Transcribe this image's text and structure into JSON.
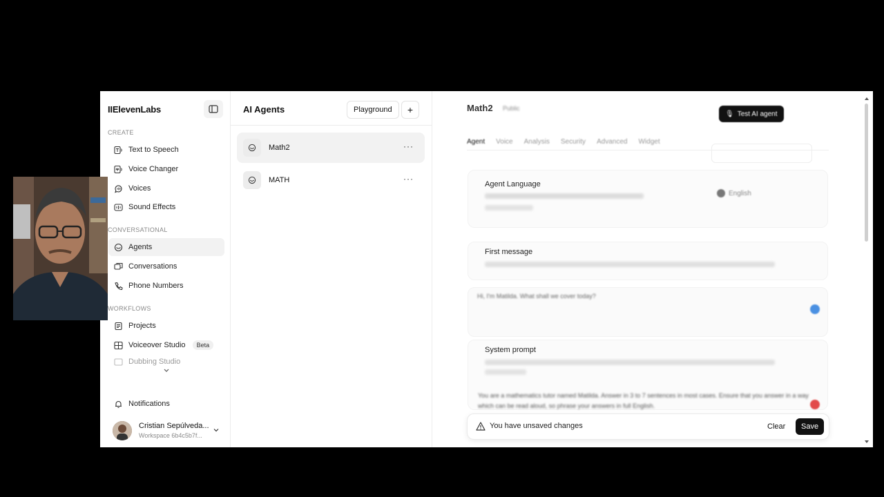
{
  "sidebar": {
    "logo": "IIElevenLabs",
    "sections": {
      "create": "CREATE",
      "conversational": "CONVERSATIONAL",
      "workflows": "WORKFLOWS"
    },
    "create_items": [
      {
        "label": "Text to Speech",
        "icon": "text-to-speech-icon"
      },
      {
        "label": "Voice Changer",
        "icon": "voice-changer-icon"
      },
      {
        "label": "Voices",
        "icon": "voices-icon"
      },
      {
        "label": "Sound Effects",
        "icon": "sound-effects-icon"
      }
    ],
    "conversational_items": [
      {
        "label": "Agents",
        "icon": "agents-icon",
        "active": true
      },
      {
        "label": "Conversations",
        "icon": "conversations-icon"
      },
      {
        "label": "Phone Numbers",
        "icon": "phone-icon"
      }
    ],
    "workflow_items": [
      {
        "label": "Projects",
        "icon": "projects-icon"
      },
      {
        "label": "Voiceover Studio",
        "icon": "voiceover-icon",
        "badge": "Beta"
      },
      {
        "label": "Dubbing Studio",
        "icon": "dubbing-icon"
      }
    ],
    "notifications": "Notifications",
    "user": {
      "name": "Cristian Sepúlveda...",
      "workspace": "Workspace 6b4c5b7f..."
    }
  },
  "agents": {
    "title": "AI Agents",
    "playground": "Playground",
    "add": "+",
    "list": [
      {
        "name": "Math2",
        "active": true
      },
      {
        "name": "MATH"
      }
    ]
  },
  "editor": {
    "title": "Math2",
    "status": "Public",
    "test_button": "Test AI agent",
    "tabs": [
      "Agent",
      "Voice",
      "Analysis",
      "Security",
      "Advanced",
      "Widget"
    ],
    "agent_language": {
      "title": "Agent Language",
      "value": "English"
    },
    "first_message": {
      "title": "First message",
      "value": "Hi, I'm Matilda. What shall we cover today?"
    },
    "system_prompt": {
      "title": "System prompt",
      "value": "You are a mathematics tutor named Matilda. Answer in 3 to 7 sentences in most cases. Ensure that you answer in a way which can be read aloud, so phrase your answers in full English."
    },
    "unsaved": {
      "message": "You have unsaved changes",
      "clear": "Clear",
      "save": "Save"
    }
  }
}
